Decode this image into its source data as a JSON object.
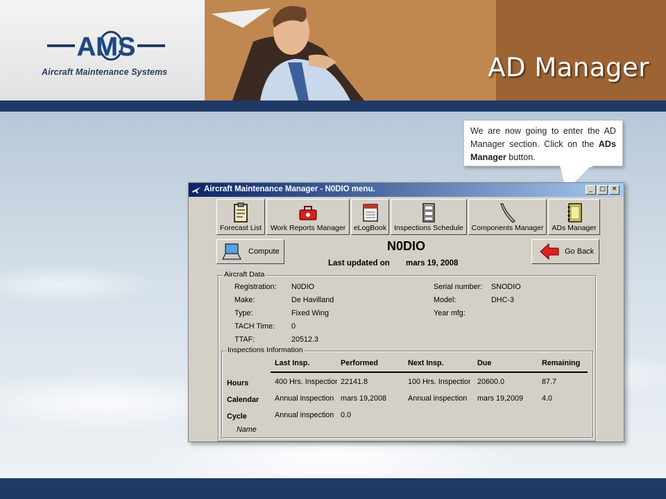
{
  "header": {
    "logo_text": "Aircraft Maintenance Systems",
    "logo_letters": "AMS",
    "page_title": "AD Manager"
  },
  "callout": {
    "text_before": "We are now going to enter the AD Manager section. Click on the ",
    "text_bold": "ADs Manager",
    "text_after": " button."
  },
  "window": {
    "title": "Aircraft Maintenance Manager - N0DIO menu.",
    "toolbar": [
      {
        "label": "Forecast List",
        "icon": "clipboard-icon"
      },
      {
        "label": "Work Reports Manager",
        "icon": "toolbox-icon"
      },
      {
        "label": "eLogBook",
        "icon": "logbook-icon"
      },
      {
        "label": "Inspections Schedule",
        "icon": "cabinet-icon"
      },
      {
        "label": "Components Manager",
        "icon": "wrench-icon"
      },
      {
        "label": "ADs Manager",
        "icon": "notebook-icon"
      }
    ],
    "compute_label": "Compute",
    "go_back_label": "Go Back",
    "registration_title": "N0DIO",
    "last_updated_label": "Last updated on",
    "last_updated_value": "mars 19, 2008"
  },
  "aircraft_data": {
    "group_label": "Aircraft Data",
    "fields_left": [
      {
        "label": "Registration:",
        "value": "N0DIO"
      },
      {
        "label": "Make:",
        "value": "De Havilland"
      },
      {
        "label": "Type:",
        "value": "Fixed Wing"
      },
      {
        "label": "TACH Time:",
        "value": "0"
      },
      {
        "label": "TTAF:",
        "value": "20512.3"
      }
    ],
    "fields_right": [
      {
        "label": "Serial number:",
        "value": "SNODIO"
      },
      {
        "label": "Model:",
        "value": "DHC-3"
      },
      {
        "label": "Year mfg:",
        "value": ""
      }
    ]
  },
  "inspections": {
    "group_label": "Inspections Information",
    "headers": [
      "Last Insp.",
      "Performed",
      "Next Insp.",
      "Due",
      "Remaining"
    ],
    "rows": [
      {
        "label": "Hours",
        "last": "400 Hrs. Inspection",
        "performed": "22141.8",
        "next": "100 Hrs. Inspection",
        "due": "20600.0",
        "remaining": "87.7"
      },
      {
        "label": "Calendar",
        "last": "Annual inspection",
        "performed": "mars 19,2008",
        "next": "Annual inspection",
        "due": "mars 19,2009",
        "remaining": "4.0"
      },
      {
        "label": "Cycle",
        "last": "Annual inspection",
        "performed": "0.0",
        "next": "",
        "due": "",
        "remaining": ""
      }
    ],
    "footer_label": "Name"
  },
  "colors": {
    "band": "#1f3a66",
    "titlebar_start": "#0a246a",
    "titlebar_end": "#a6caf0",
    "window_bg": "#d4d0c8"
  }
}
